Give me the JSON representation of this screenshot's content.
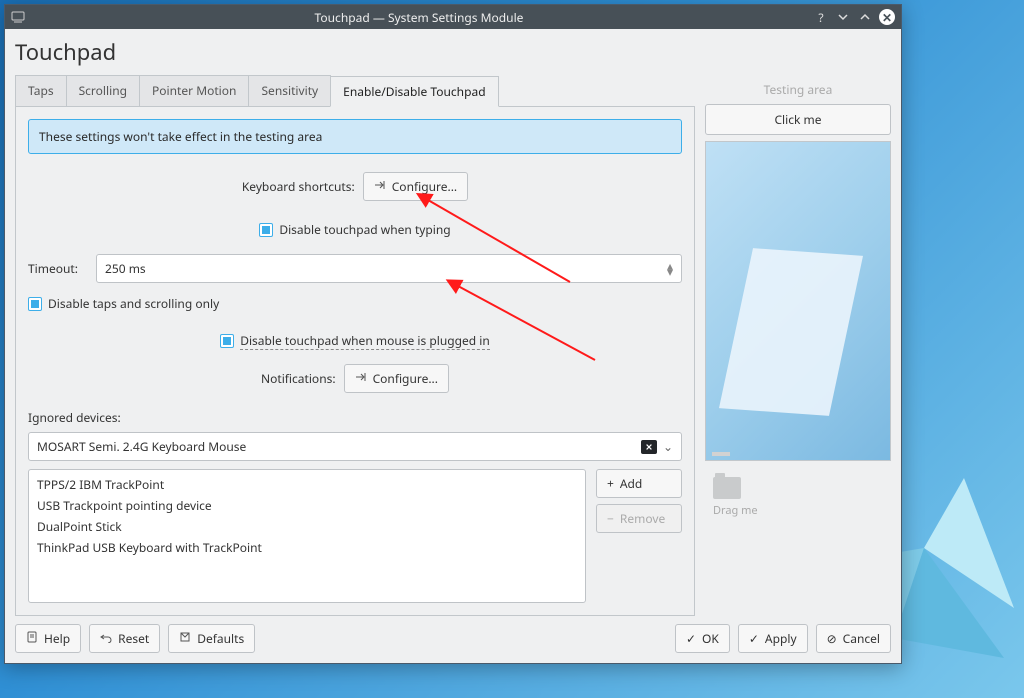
{
  "window": {
    "title": "Touchpad — System Settings Module"
  },
  "page": {
    "title": "Touchpad"
  },
  "tabs": [
    "Taps",
    "Scrolling",
    "Pointer Motion",
    "Sensitivity",
    "Enable/Disable Touchpad"
  ],
  "active_tab": 4,
  "panel": {
    "notice": "These settings won't take effect in the testing area",
    "kb_shortcuts_label": "Keyboard shortcuts:",
    "configure_label": "Configure...",
    "disable_typing_label": "Disable touchpad when typing",
    "timeout_label": "Timeout:",
    "timeout_value": "250 ms",
    "disable_taps_label": "Disable taps and scrolling only",
    "disable_mouse_label": "Disable touchpad when mouse is plugged in",
    "notifications_label": "Notifications:",
    "ignored_label": "Ignored devices:",
    "ignored_combo": "MOSART Semi. 2.4G Keyboard Mouse",
    "device_list": [
      "TPPS/2 IBM TrackPoint",
      "USB Trackpoint pointing device",
      "DualPoint Stick",
      "ThinkPad USB Keyboard with TrackPoint"
    ],
    "add_label": "Add",
    "remove_label": "Remove"
  },
  "side": {
    "testing_label": "Testing area",
    "click_label": "Click me",
    "drag_label": "Drag me"
  },
  "footer": {
    "help": "Help",
    "reset": "Reset",
    "defaults": "Defaults",
    "ok": "OK",
    "apply": "Apply",
    "cancel": "Cancel"
  }
}
